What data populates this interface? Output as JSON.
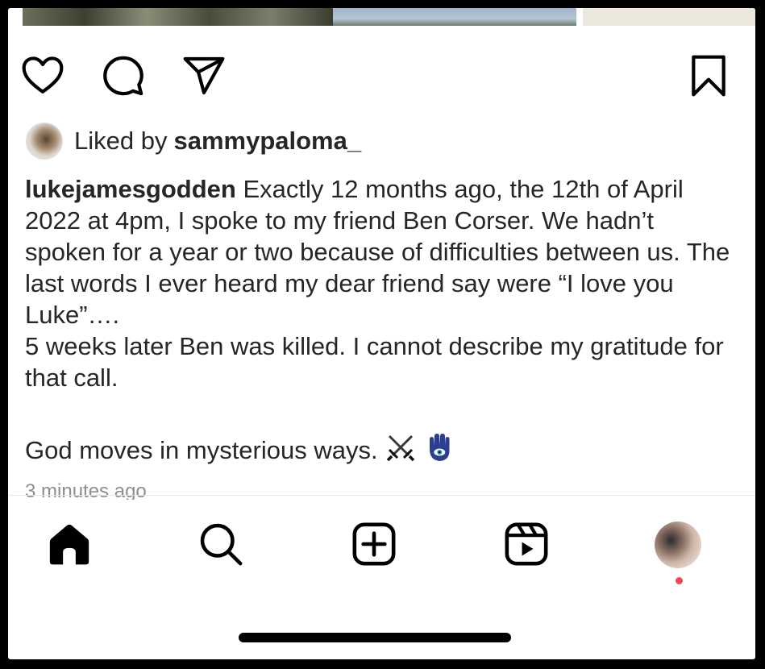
{
  "post": {
    "liked_prefix": "Liked by",
    "liked_user": "sammypaloma_",
    "caption_user": "lukejamesgodden",
    "caption_line1": "Exactly 12 months ago, the 12th of April 2022 at 4pm, I spoke to my friend Ben Corser. We hadn’t spoken for a year or two because of difficulties between us. The last words I ever heard my dear friend say were “I love you Luke”….",
    "caption_line2": "5 weeks later Ben was killed. I cannot describe my gratitude for that call.",
    "caption_line3": "God moves in mysterious ways.",
    "timestamp": "3 minutes ago"
  },
  "icons": {
    "like": "heart-icon",
    "comment": "comment-icon",
    "share": "paper-plane-icon",
    "save": "bookmark-icon",
    "emoji1": "crossed-swords-emoji",
    "emoji2": "hamsa-emoji",
    "home": "home-icon",
    "search": "search-icon",
    "create": "plus-square-icon",
    "reels": "reels-icon"
  },
  "colors": {
    "text": "#262626",
    "muted": "#8e8e8e",
    "notification_dot": "#ed4956"
  }
}
